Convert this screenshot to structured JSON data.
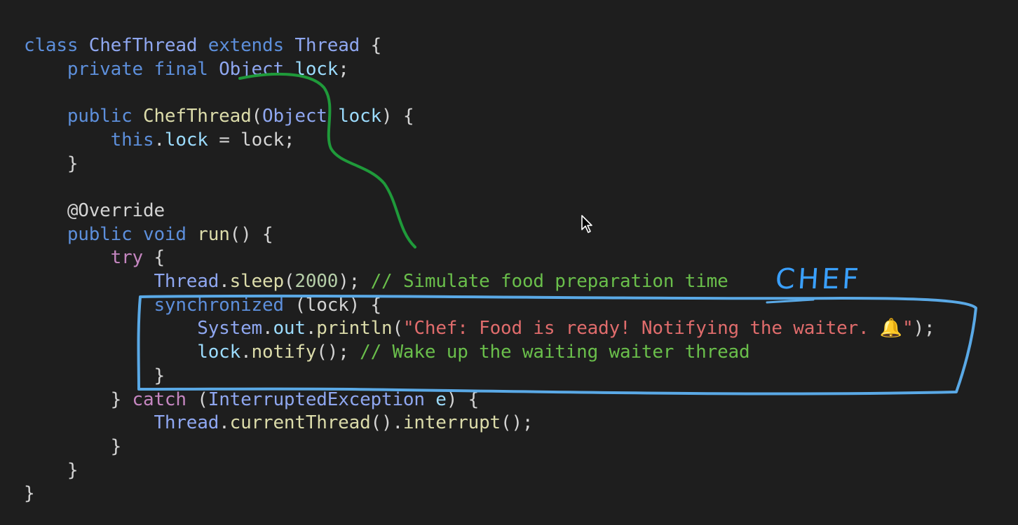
{
  "code_lines": [
    [
      {
        "t": "class ",
        "c": "kw"
      },
      {
        "t": "ChefThread ",
        "c": "typ"
      },
      {
        "t": "extends ",
        "c": "kw"
      },
      {
        "t": "Thread ",
        "c": "typ"
      },
      {
        "t": "{",
        "c": "pl"
      }
    ],
    [
      {
        "t": "    private final ",
        "c": "kw"
      },
      {
        "t": "Object ",
        "c": "typ"
      },
      {
        "t": "lock",
        "c": "mem"
      },
      {
        "t": ";",
        "c": "pl"
      }
    ],
    [],
    [
      {
        "t": "    public ",
        "c": "kw"
      },
      {
        "t": "ChefThread",
        "c": "fn"
      },
      {
        "t": "(",
        "c": "pl"
      },
      {
        "t": "Object ",
        "c": "typ"
      },
      {
        "t": "lock",
        "c": "mem"
      },
      {
        "t": ") {",
        "c": "pl"
      }
    ],
    [
      {
        "t": "        this",
        "c": "kw"
      },
      {
        "t": ".",
        "c": "pl"
      },
      {
        "t": "lock",
        "c": "mem"
      },
      {
        "t": " = lock;",
        "c": "pl"
      }
    ],
    [
      {
        "t": "    }",
        "c": "pl"
      }
    ],
    [],
    [
      {
        "t": "    @Override",
        "c": "pl"
      }
    ],
    [
      {
        "t": "    public ",
        "c": "kw"
      },
      {
        "t": "void ",
        "c": "kw"
      },
      {
        "t": "run",
        "c": "fn"
      },
      {
        "t": "() {",
        "c": "pl"
      }
    ],
    [
      {
        "t": "        try ",
        "c": "kwc"
      },
      {
        "t": "{",
        "c": "pl"
      }
    ],
    [
      {
        "t": "            Thread",
        "c": "typ"
      },
      {
        "t": ".",
        "c": "pl"
      },
      {
        "t": "sleep",
        "c": "fn"
      },
      {
        "t": "(",
        "c": "pl"
      },
      {
        "t": "2000",
        "c": "num"
      },
      {
        "t": "); ",
        "c": "pl"
      },
      {
        "t": "// Simulate food preparation time",
        "c": "cm"
      }
    ],
    [
      {
        "t": "            synchronized ",
        "c": "kw"
      },
      {
        "t": "(lock) {",
        "c": "pl"
      }
    ],
    [
      {
        "t": "                System",
        "c": "typ"
      },
      {
        "t": ".",
        "c": "pl"
      },
      {
        "t": "out",
        "c": "mem"
      },
      {
        "t": ".",
        "c": "pl"
      },
      {
        "t": "println",
        "c": "fn"
      },
      {
        "t": "(",
        "c": "pl"
      },
      {
        "t": "\"Chef: Food is ready! Notifying the waiter. ",
        "c": "str"
      },
      {
        "t": "🔔",
        "c": "emoji"
      },
      {
        "t": "\"",
        "c": "str"
      },
      {
        "t": ");",
        "c": "pl"
      }
    ],
    [
      {
        "t": "                lock",
        "c": "mem"
      },
      {
        "t": ".",
        "c": "pl"
      },
      {
        "t": "notify",
        "c": "fn"
      },
      {
        "t": "(); ",
        "c": "pl"
      },
      {
        "t": "// Wake up the waiting waiter thread",
        "c": "cm"
      }
    ],
    [
      {
        "t": "            }",
        "c": "pl"
      }
    ],
    [
      {
        "t": "        } ",
        "c": "pl"
      },
      {
        "t": "catch ",
        "c": "kwc"
      },
      {
        "t": "(",
        "c": "pl"
      },
      {
        "t": "InterruptedException ",
        "c": "typ"
      },
      {
        "t": "e",
        "c": "mem"
      },
      {
        "t": ") {",
        "c": "pl"
      }
    ],
    [
      {
        "t": "            Thread",
        "c": "typ"
      },
      {
        "t": ".",
        "c": "pl"
      },
      {
        "t": "currentThread",
        "c": "fn"
      },
      {
        "t": "().",
        "c": "pl"
      },
      {
        "t": "interrupt",
        "c": "fn"
      },
      {
        "t": "();",
        "c": "pl"
      }
    ],
    [
      {
        "t": "        }",
        "c": "pl"
      }
    ],
    [
      {
        "t": "    }",
        "c": "pl"
      }
    ],
    [
      {
        "t": "}",
        "c": "pl"
      }
    ]
  ],
  "annotation": {
    "label": "CHEF",
    "label_color": "#3aa0ff",
    "box_color": "#5aa9e6",
    "curve_color": "#1f9a3a"
  },
  "icons": {
    "cursor": "mouse-pointer-icon",
    "bell": "bell-emoji"
  },
  "colors": {
    "background": "#1e1e1e",
    "keyword": "#5d8fdb",
    "control_keyword": "#c586c0",
    "type": "#8fa7f0",
    "function": "#dcdcaa",
    "member": "#9cdcfe",
    "number": "#b5cea8",
    "string": "#e06c6c",
    "comment": "#6abf4b",
    "plain": "#d4d4d4"
  }
}
